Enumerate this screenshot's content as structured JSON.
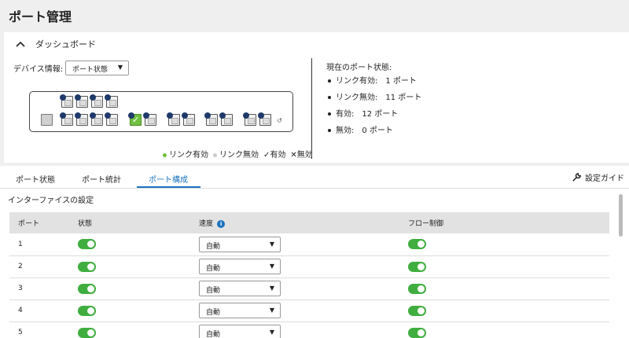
{
  "page": {
    "title": "ポート管理"
  },
  "dashboard": {
    "header": "ダッシュボード",
    "device_label": "デバイス情報:",
    "device_select": "ポート状態",
    "legend": {
      "link_up": "リンク有効",
      "link_down": "リンク無効",
      "enabled": "✓有効",
      "disabled": "✕無効"
    },
    "status": {
      "title": "現在のポート状態:",
      "items": [
        "リンク有効:　1 ポート",
        "リンク無効:　11 ポート",
        "有効:　12 ポート",
        "無効:　0 ポート"
      ]
    },
    "colors": {
      "link_up": "#6fc040",
      "link_down": "#cccccc",
      "port_badge": "#1f3a6a"
    }
  },
  "tabs": [
    {
      "label": "ポート状態"
    },
    {
      "label": "ポート統計"
    },
    {
      "label": "ポート構成",
      "active": true
    }
  ],
  "guide_label": "設定ガイド",
  "config": {
    "title": "インターファイスの設定",
    "columns": [
      "ポート",
      "状態",
      "速度",
      "フロー制御"
    ],
    "rows": [
      {
        "port": "1",
        "speed": "自動"
      },
      {
        "port": "2",
        "speed": "自動"
      },
      {
        "port": "3",
        "speed": "自動"
      },
      {
        "port": "4",
        "speed": "自動"
      },
      {
        "port": "5",
        "speed": "自動"
      }
    ],
    "accent": "#1a73c0",
    "toggle_color": "#3fae3f"
  }
}
